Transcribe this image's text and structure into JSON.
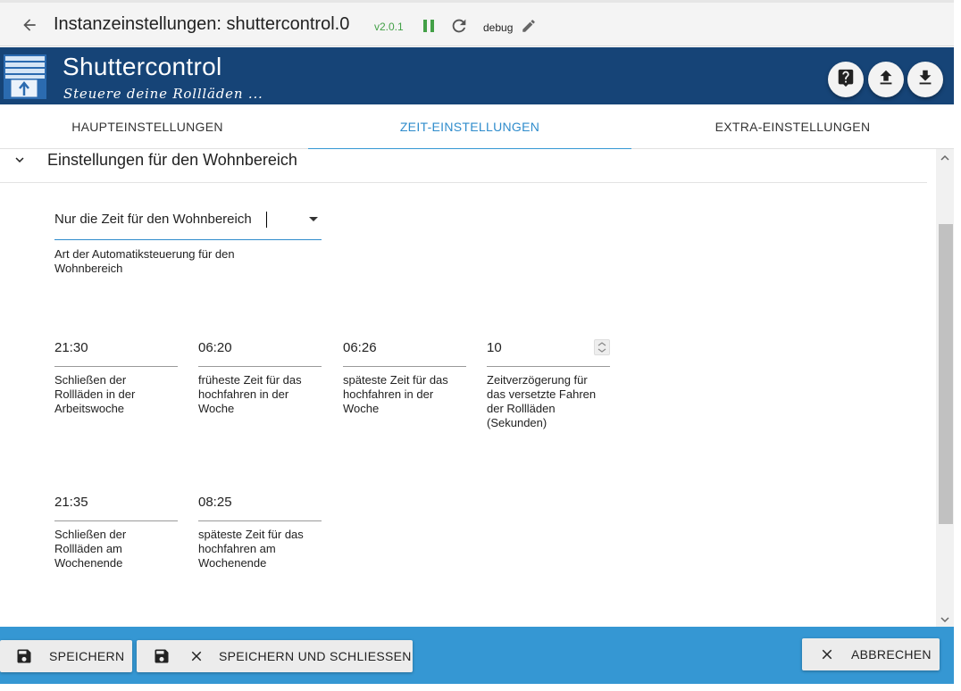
{
  "topbar": {
    "title": "Instanzeinstellungen: shuttercontrol.0",
    "version": "v2.0.1",
    "loglevel": "debug"
  },
  "banner": {
    "app_name": "Shuttercontrol",
    "subtitle": "Steuere deine Rollläden ..."
  },
  "tabs": [
    {
      "label": "HAUPTEINSTELLUNGEN",
      "active": false
    },
    {
      "label": "ZEIT-EINSTELLUNGEN",
      "active": true
    },
    {
      "label": "EXTRA-EINSTELLUNGEN",
      "active": false
    }
  ],
  "section": {
    "title": "Einstellungen für den Wohnbereich",
    "mode_select": {
      "value": "Nur die Zeit für den Wohnbereich",
      "helper": [
        "Art der Automatiksteuerung für den",
        "Wohnbereich"
      ]
    },
    "fields": [
      {
        "value": "21:30",
        "label": [
          "Schließen der",
          "Rollläden in der",
          "Arbeitswoche"
        ]
      },
      {
        "value": "06:20",
        "label": [
          "früheste Zeit für das",
          "hochfahren in der",
          "Woche"
        ]
      },
      {
        "value": "06:26",
        "label": [
          "späteste Zeit für das",
          "hochfahren in der",
          "Woche"
        ]
      },
      {
        "value": "10",
        "label": [
          "Zeitverzögerung für",
          "das versetzte Fahren",
          "der Rollläden",
          "(Sekunden)"
        ]
      },
      {
        "value": "21:35",
        "label": [
          "Schließen der",
          "Rollläden am",
          "Wochenende"
        ]
      },
      {
        "value": "08:25",
        "label": [
          "späteste Zeit für das",
          "hochfahren am",
          "Wochenende"
        ]
      }
    ]
  },
  "footer": {
    "save_label": "SPEICHERN",
    "save_close_label": "SPEICHERN UND SCHLIESSEN",
    "cancel_label": "ABBRECHEN"
  },
  "colors": {
    "banner": "#164477",
    "accent": "#3597d3",
    "running": "#43a047"
  }
}
